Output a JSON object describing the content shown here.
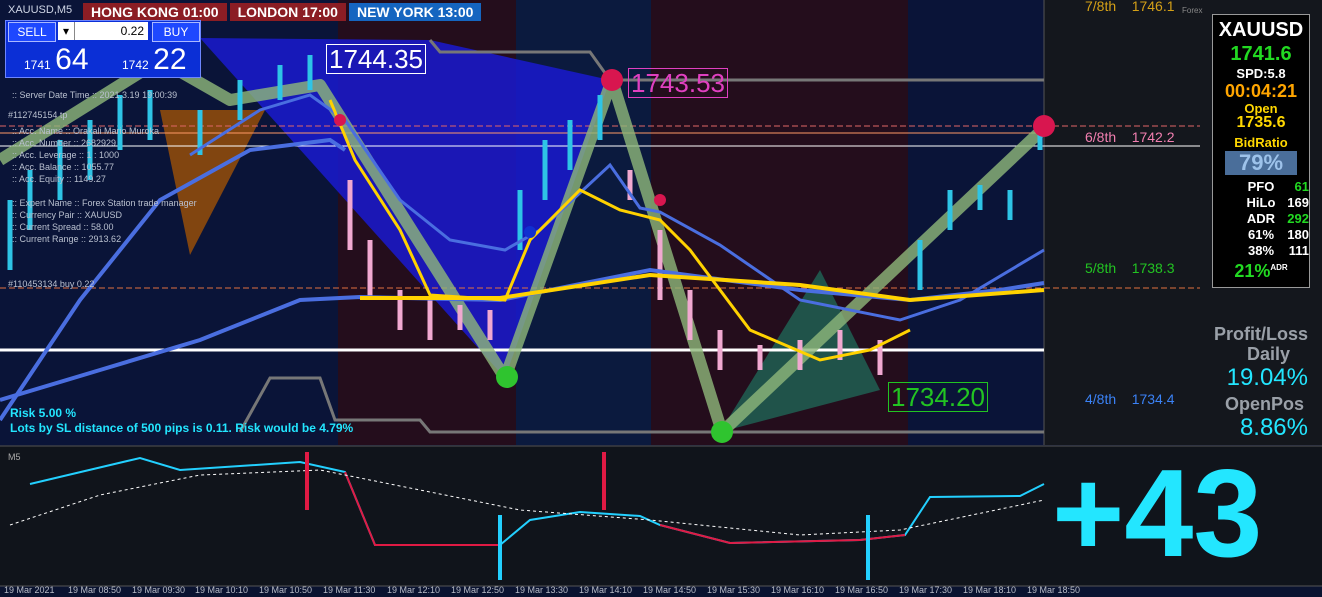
{
  "symbol": "XAUUSD,M5",
  "sessions": [
    {
      "name": "HONG KONG",
      "time": "01:00",
      "color": "#8b1d24"
    },
    {
      "name": "LONDON",
      "time": "17:00",
      "color": "#8b1d24"
    },
    {
      "name": "NEW YORK",
      "time": "13:00",
      "color": "#1565c0"
    }
  ],
  "trade": {
    "sell": "SELL",
    "buy": "BUY",
    "lot": "0.22",
    "bid_prefix": "1741",
    "bid_big": "64",
    "ask_prefix": "1742",
    "ask_big": "22"
  },
  "account": [
    ":: Server Date Time :: 2021.3.19 19:00:39",
    ":: Acc. Name :: Orakali Mario Muroka",
    ":: Acc. Number :: 2682929",
    ":: Acc. Leverage :: 1 : 1000",
    ":: Acc. Balance :: 1055.77",
    ":: Acc. Equity :: 1149.27",
    ":: Expert Name :: Forex Station trade manager",
    ":: Currency Pair :: XAUUSD",
    ":: Current Spread :: 58.00",
    ":: Current Range :: 2913.62"
  ],
  "order_labels": [
    "#112745154 tp",
    "#110453134 buy 0.22"
  ],
  "price_tags": [
    {
      "text": "1744.35",
      "color": "#ffffff"
    },
    {
      "text": "1743.53",
      "color": "#e040c0"
    },
    {
      "text": "1734.20",
      "color": "#22c422"
    }
  ],
  "levels": [
    {
      "label": "7/8th",
      "value": "1746.1",
      "color": "#d4a017"
    },
    {
      "label": "6/8th",
      "value": "1742.2",
      "color": "#f27fb0"
    },
    {
      "label": "5/8th",
      "value": "1738.3",
      "color": "#22c422"
    },
    {
      "label": "4/8th",
      "value": "1734.4",
      "color": "#3b82f6"
    }
  ],
  "forex_tag": "Forex",
  "risk": {
    "line1": "Risk 5.00 %",
    "line2": "Lots by SL distance of 500 pips is 0.11. Risk would be 4.79%"
  },
  "panel": {
    "symbol": "XAUUSD",
    "price": "1741.6",
    "spread": "SPD:5.8",
    "timer": "00:04:21",
    "open_label": "Open",
    "open": "1735.6",
    "bidratio_label": "BidRatio",
    "bidratio": "79%",
    "rows": [
      {
        "k": "PFO",
        "v": "61"
      },
      {
        "k": "HiLo",
        "v": "169"
      },
      {
        "k": "ADR",
        "v": "292"
      },
      {
        "k": "61%",
        "v": "180"
      },
      {
        "k": "38%",
        "v": "111"
      }
    ],
    "adr_pct": "21%",
    "adr_sup": "ADR"
  },
  "profit": {
    "title1": "Profit/Loss",
    "title2": "Daily",
    "daily": "19.04%",
    "openpos_label": "OpenPos",
    "openpos": "8.86%"
  },
  "sub_label": "M5",
  "big_number": "+43",
  "times": [
    "19 Mar 2021",
    "19 Mar 08:50",
    "19 Mar 09:30",
    "19 Mar 10:10",
    "19 Mar 10:50",
    "19 Mar 11:30",
    "19 Mar 12:10",
    "19 Mar 12:50",
    "19 Mar 13:30",
    "19 Mar 14:10",
    "19 Mar 14:50",
    "19 Mar 15:30",
    "19 Mar 16:10",
    "19 Mar 16:50",
    "19 Mar 17:30",
    "19 Mar 18:10",
    "19 Mar 18:50"
  ]
}
